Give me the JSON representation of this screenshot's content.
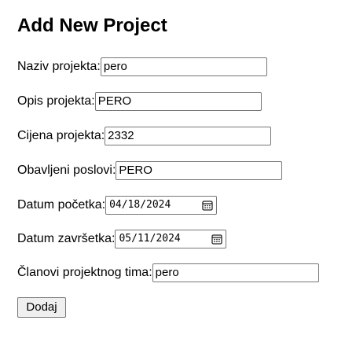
{
  "page": {
    "title": "Add New Project"
  },
  "form": {
    "fields": [
      {
        "label": "Naziv projekta:",
        "value": "pero"
      },
      {
        "label": "Opis projekta:",
        "value": "PERO"
      },
      {
        "label": "Cijena projekta:",
        "value": "2332"
      },
      {
        "label": "Obavljeni poslovi:",
        "value": "PERO"
      },
      {
        "label": "Datum početka:",
        "value": "04/18/2024"
      },
      {
        "label": "Datum završetka:",
        "value": "05/11/2024"
      },
      {
        "label": "Članovi projektnog tima:",
        "value": "pero"
      }
    ],
    "submit_label": "Dodaj"
  },
  "icons": {
    "date_picker": "calendar-icon"
  }
}
